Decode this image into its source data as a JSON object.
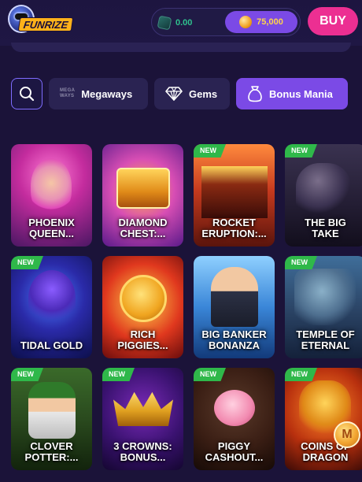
{
  "header": {
    "logo_text": "FUNRIZE",
    "entries_balance": "0.00",
    "coins_balance": "75,000",
    "buy_label": "BUY"
  },
  "filters": {
    "search_icon": "search-icon",
    "items": [
      {
        "label": "Megaways",
        "prefix": "MEGA\nWAYS",
        "icon": "megaways-logo"
      },
      {
        "label": "Gems",
        "icon": "diamond-icon"
      },
      {
        "label": "Bonus Mania",
        "icon": "money-bag-icon",
        "active": true
      }
    ]
  },
  "games": [
    {
      "name": "PHOENIX\nQUEEN...",
      "new": false
    },
    {
      "name": "DIAMOND\nCHEST:...",
      "new": false
    },
    {
      "name": "ROCKET\nERUPTION:...",
      "new": true
    },
    {
      "name": "THE BIG\nTAKE",
      "new": true
    },
    {
      "name": "TIDAL GOLD",
      "new": true
    },
    {
      "name": "RICH\nPIGGIES...",
      "new": false
    },
    {
      "name": "BIG BANKER\nBONANZA",
      "new": false
    },
    {
      "name": "TEMPLE OF\nETERNAL",
      "new": true
    },
    {
      "name": "CLOVER\nPOTTER:...",
      "new": true
    },
    {
      "name": "3 CROWNS:\nBONUS...",
      "new": true
    },
    {
      "name": "PIGGY\nCASHOUT...",
      "new": true
    },
    {
      "name": "COINS OF\nDRAGON",
      "new": true
    }
  ],
  "badge_new_label": "NEW",
  "floating_badge_label": "M",
  "colors": {
    "accent": "#7b4ae6",
    "buy": "#ec2f92",
    "new_badge": "#2fb84a",
    "background": "#1b1339"
  }
}
